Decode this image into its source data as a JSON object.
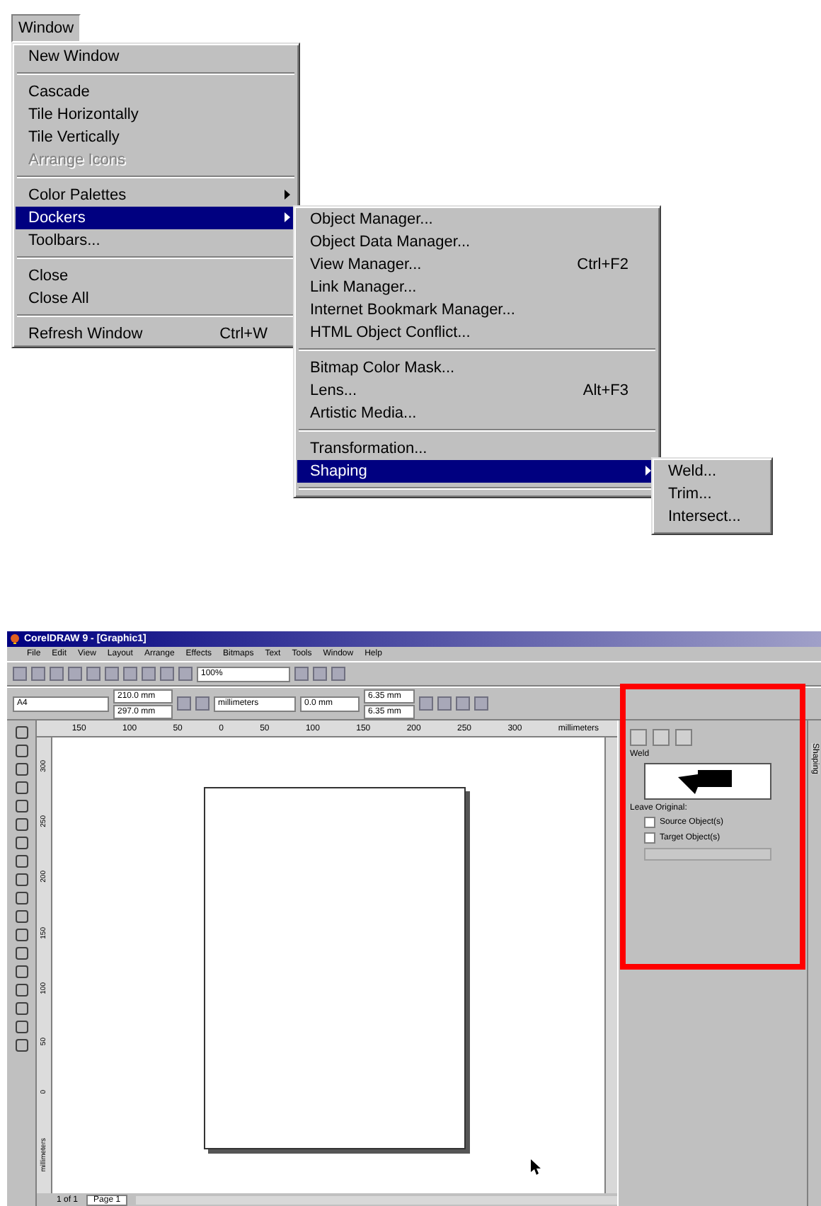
{
  "menu_bar": {
    "label": "Window",
    "selected": true
  },
  "window_menu": {
    "items": [
      {
        "kind": "item",
        "label": "New Window",
        "disabled": false,
        "selected": false,
        "submenu": false
      },
      {
        "kind": "separator"
      },
      {
        "kind": "item",
        "label": "Cascade",
        "disabled": false,
        "selected": false,
        "submenu": false
      },
      {
        "kind": "item",
        "label": "Tile Horizontally",
        "disabled": false,
        "selected": false,
        "submenu": false
      },
      {
        "kind": "item",
        "label": "Tile Vertically",
        "disabled": false,
        "selected": false,
        "submenu": false
      },
      {
        "kind": "item",
        "label": "Arrange Icons",
        "disabled": true,
        "selected": false,
        "submenu": false
      },
      {
        "kind": "separator"
      },
      {
        "kind": "item",
        "label": "Color Palettes",
        "disabled": false,
        "selected": false,
        "submenu": true
      },
      {
        "kind": "item",
        "label": "Dockers",
        "disabled": false,
        "selected": true,
        "submenu": true
      },
      {
        "kind": "item",
        "label": "Toolbars...",
        "disabled": false,
        "selected": false,
        "submenu": false
      },
      {
        "kind": "separator"
      },
      {
        "kind": "item",
        "label": "Close",
        "disabled": false,
        "selected": false,
        "submenu": false
      },
      {
        "kind": "item",
        "label": "Close All",
        "disabled": false,
        "selected": false,
        "submenu": false
      },
      {
        "kind": "separator"
      },
      {
        "kind": "item",
        "label": "Refresh Window",
        "shortcut": "Ctrl+W",
        "disabled": false,
        "selected": false,
        "submenu": false
      }
    ]
  },
  "dockers_menu": {
    "items": [
      {
        "kind": "item",
        "label": "Object Manager...",
        "selected": false,
        "submenu": false
      },
      {
        "kind": "item",
        "label": "Object Data Manager...",
        "selected": false,
        "submenu": false
      },
      {
        "kind": "item",
        "label": "View Manager...",
        "shortcut": "Ctrl+F2",
        "selected": false,
        "submenu": false
      },
      {
        "kind": "item",
        "label": "Link Manager...",
        "selected": false,
        "submenu": false
      },
      {
        "kind": "item",
        "label": "Internet Bookmark Manager...",
        "selected": false,
        "submenu": false
      },
      {
        "kind": "item",
        "label": "HTML Object Conflict...",
        "selected": false,
        "submenu": false
      },
      {
        "kind": "separator"
      },
      {
        "kind": "item",
        "label": "Bitmap Color Mask...",
        "selected": false,
        "submenu": false
      },
      {
        "kind": "item",
        "label": "Lens...",
        "shortcut": "Alt+F3",
        "selected": false,
        "submenu": false
      },
      {
        "kind": "item",
        "label": "Artistic Media...",
        "selected": false,
        "submenu": false
      },
      {
        "kind": "separator"
      },
      {
        "kind": "item",
        "label": "Transformation...",
        "selected": false,
        "submenu": false
      },
      {
        "kind": "item",
        "label": "Shaping",
        "selected": true,
        "submenu": true
      },
      {
        "kind": "separator"
      }
    ]
  },
  "shaping_menu": {
    "items": [
      {
        "label": "Weld...",
        "selected": false
      },
      {
        "label": "Trim...",
        "selected": false
      },
      {
        "label": "Intersect...",
        "selected": false
      }
    ]
  },
  "app_window": {
    "title": "CorelDRAW 9 - [Graphic1]",
    "menus": [
      "File",
      "Edit",
      "View",
      "Layout",
      "Arrange",
      "Effects",
      "Bitmaps",
      "Text",
      "Tools",
      "Window",
      "Help"
    ],
    "zoom": "100%",
    "property_bar": {
      "paper": "A4",
      "width": "210.0 mm",
      "height": "297.0 mm",
      "units": "millimeters",
      "nudge": "0.0 mm",
      "dup_x": "6.35 mm",
      "dup_y": "6.35 mm"
    },
    "ruler_labels": [
      "150",
      "100",
      "50",
      "0",
      "50",
      "100",
      "150",
      "200",
      "250",
      "300"
    ],
    "ruler_units": "millimeters",
    "vertical_ruler_labels": [
      "300",
      "250",
      "200",
      "150",
      "100",
      "50",
      "0"
    ],
    "vertical_ruler_units": "millimeters",
    "docker": {
      "highlighted": true,
      "section": "Weld",
      "leave_original": "Leave Original:",
      "options": [
        {
          "label": "Source Object(s)",
          "checked": false
        },
        {
          "label": "Target Object(s)",
          "checked": false
        }
      ],
      "side_tab": "Shaping"
    },
    "page_counter": "1 of 1",
    "page_tab": "Page 1"
  }
}
